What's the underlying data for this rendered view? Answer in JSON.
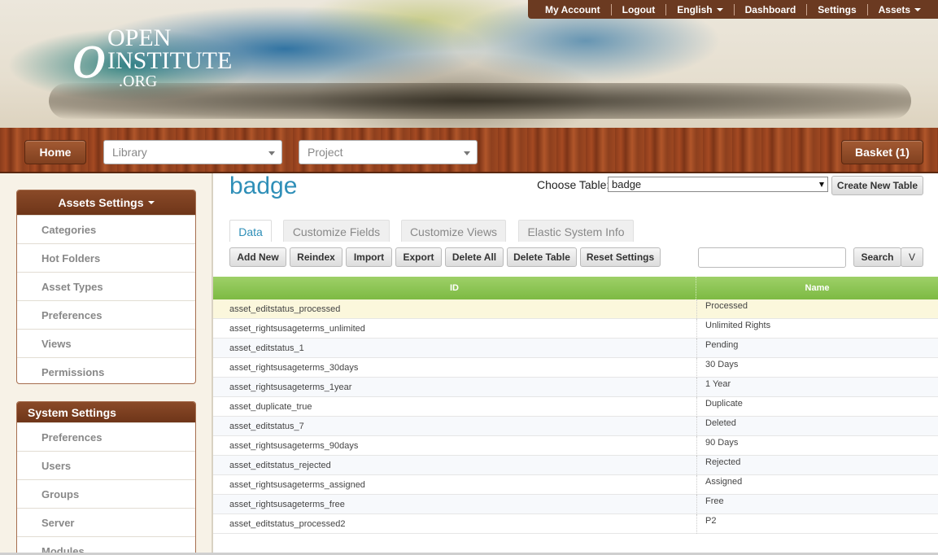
{
  "logo": {
    "mark": "o",
    "line1": "OPEN",
    "line2": "INSTITUTE",
    "line3": ".ORG"
  },
  "topmenu": {
    "items": [
      "My Account",
      "Logout",
      "English",
      "Dashboard",
      "Settings",
      "Assets"
    ]
  },
  "navbar": {
    "home": "Home",
    "library": "Library",
    "project": "Project",
    "basket": "Basket (1)"
  },
  "sidebar": {
    "assets_title": "Assets Settings",
    "assets_items": [
      "Categories",
      "Hot Folders",
      "Asset Types",
      "Preferences",
      "Views",
      "Permissions"
    ],
    "system_title": "System Settings",
    "system_items": [
      "Preferences",
      "Users",
      "Groups",
      "Server",
      "Modules"
    ]
  },
  "main": {
    "title": "badge",
    "choose_label": "Choose Table:",
    "choose_value": "badge",
    "create_button": "Create New Table",
    "tabs": [
      "Data",
      "Customize Fields",
      "Customize Views",
      "Elastic System Info"
    ],
    "toolbar": [
      "Add New",
      "Reindex",
      "Import",
      "Export",
      "Delete All",
      "Delete Table",
      "Reset Settings"
    ],
    "search_button": "Search",
    "search_more": "V"
  },
  "grid": {
    "columns": [
      "ID",
      "Name"
    ],
    "rows": [
      [
        "asset_editstatus_processed",
        "Processed"
      ],
      [
        "asset_rightsusageterms_unlimited",
        "Unlimited Rights"
      ],
      [
        "asset_editstatus_1",
        "Pending"
      ],
      [
        "asset_rightsusageterms_30days",
        "30 Days"
      ],
      [
        "asset_rightsusageterms_1year",
        "1 Year"
      ],
      [
        "asset_duplicate_true",
        "Duplicate"
      ],
      [
        "asset_editstatus_7",
        "Deleted"
      ],
      [
        "asset_rightsusageterms_90days",
        "90 Days"
      ],
      [
        "asset_editstatus_rejected",
        "Rejected"
      ],
      [
        "asset_rightsusageterms_assigned",
        "Assigned"
      ],
      [
        "asset_rightsusageterms_free",
        "Free"
      ],
      [
        "asset_editstatus_processed2",
        "P2"
      ]
    ]
  },
  "colors": {
    "brand_brown": "#6b3a21",
    "title_blue": "#2f8fb8",
    "grid_green": "#7dba43",
    "selected_row": "#fbf7dc"
  }
}
